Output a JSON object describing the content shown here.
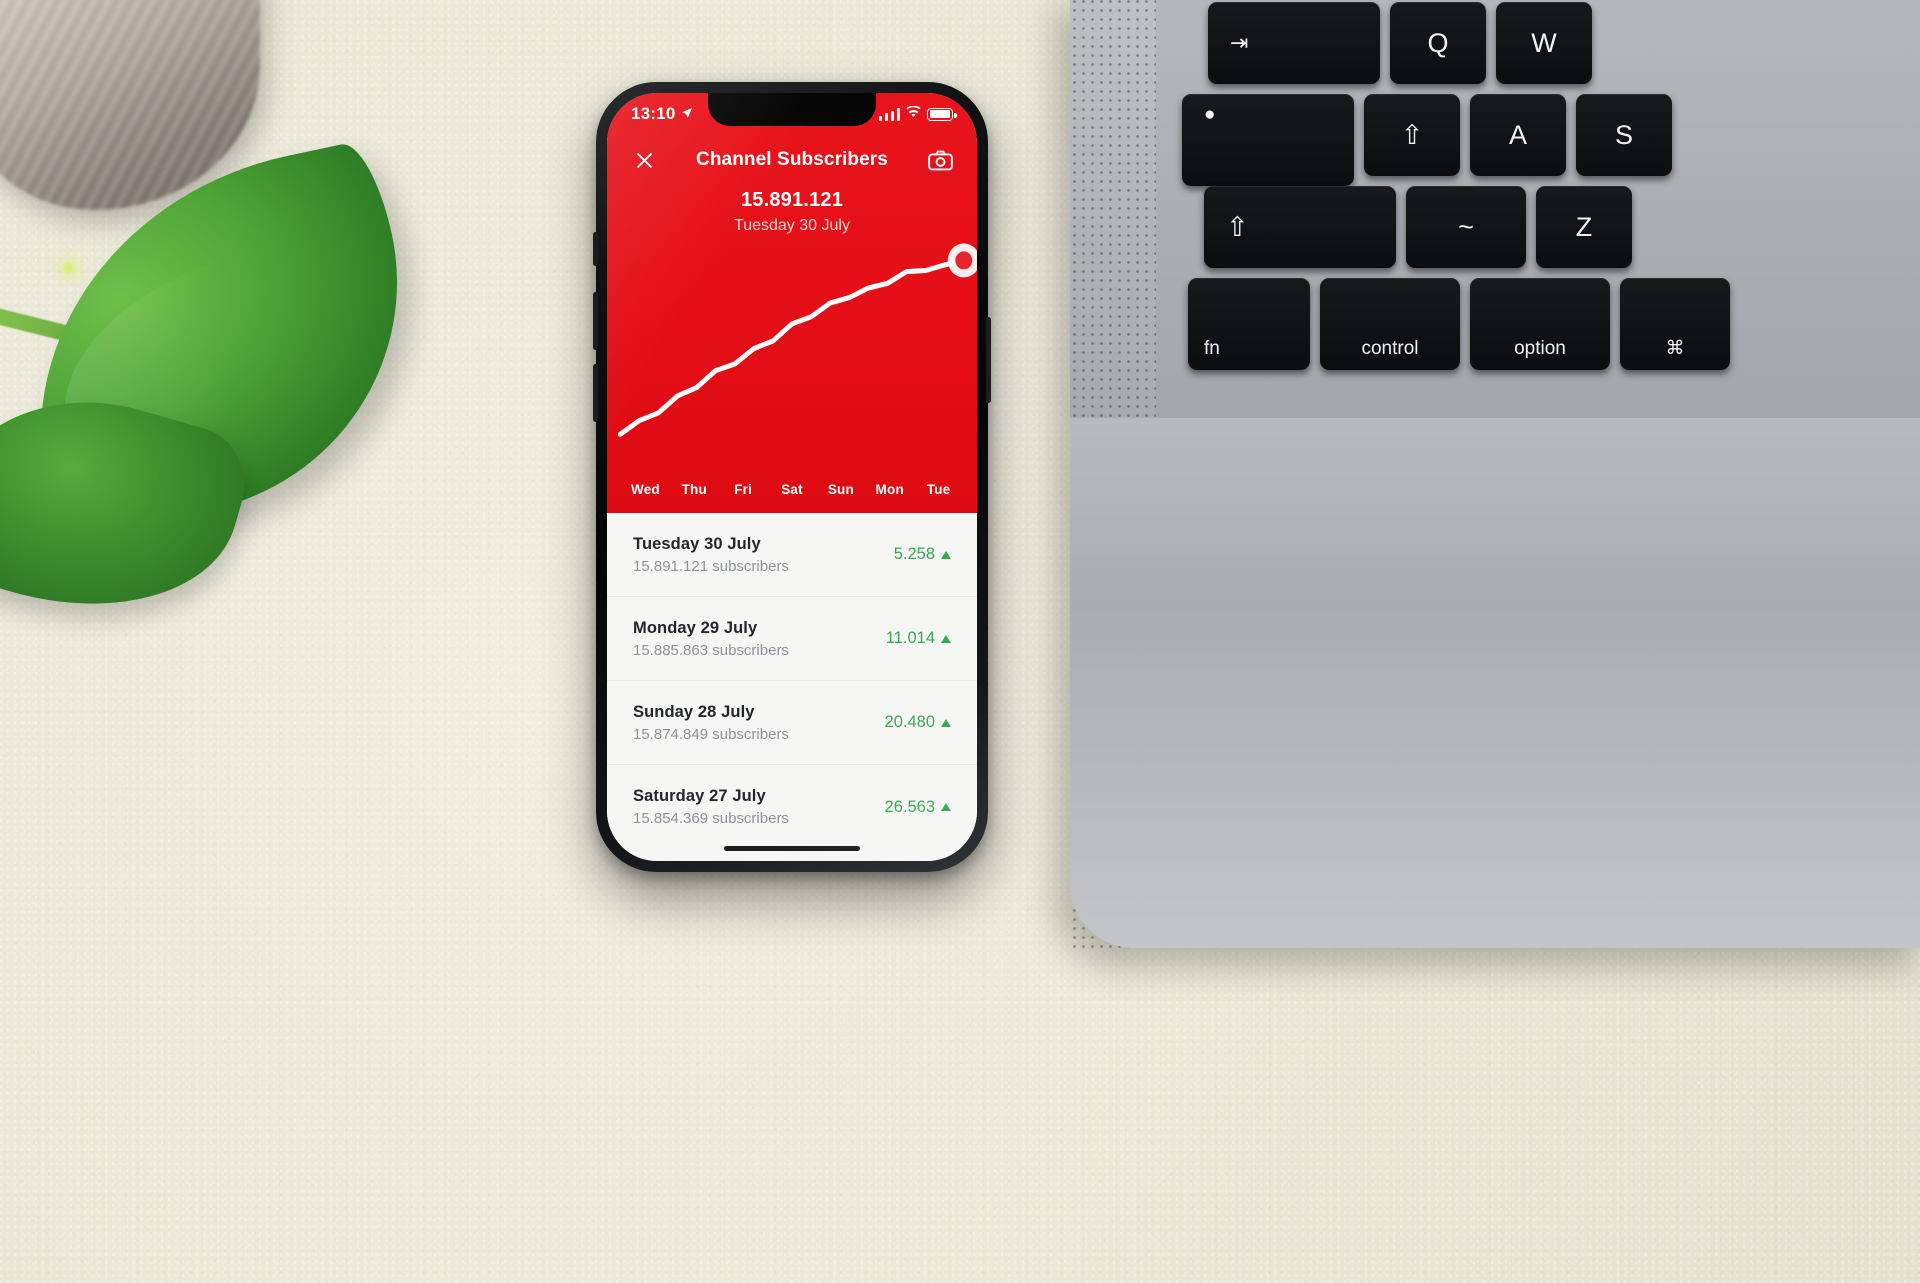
{
  "status_bar": {
    "time": "13:10",
    "location_icon": "location-arrow-icon",
    "signal_icon": "cellular-signal-icon",
    "wifi_icon": "wifi-icon",
    "battery_icon": "battery-icon"
  },
  "nav": {
    "close_icon": "close-icon",
    "title": "Channel Subscribers",
    "camera_icon": "camera-icon"
  },
  "summary": {
    "value": "15.891.121",
    "date": "Tuesday 30 July"
  },
  "chart_data": {
    "type": "line",
    "title": "Channel Subscribers",
    "xlabel": "",
    "ylabel": "",
    "grid": false,
    "legend": "none",
    "line_color": "#ffffff",
    "background_color": "#e30e16",
    "categories": [
      "Wed",
      "Thu",
      "Fri",
      "Sat",
      "Sun",
      "Mon",
      "Tue"
    ],
    "x": [
      "Wed",
      "Thu",
      "Fri",
      "Sat",
      "Sun",
      "Mon",
      "Tue"
    ],
    "series": [
      {
        "name": "Subscribers",
        "values": [
          15680000,
          15724000,
          15768000,
          15812000,
          15848000,
          15874849,
          15891121
        ]
      }
    ],
    "ylim": [
      15650000,
      15905000
    ],
    "selected_point": {
      "x": "Tue",
      "y": 15891121,
      "label": "15.891.121"
    },
    "annotations": [
      "Selected point marker on Tuesday 30 July"
    ]
  },
  "axis": {
    "days": [
      "Wed",
      "Thu",
      "Fri",
      "Sat",
      "Sun",
      "Mon",
      "Tue"
    ]
  },
  "list": {
    "rows": [
      {
        "title": "Tuesday 30 July",
        "subtitle": "15.891.121 subscribers",
        "delta": "5.258",
        "trend": "up"
      },
      {
        "title": "Monday 29 July",
        "subtitle": "15.885.863 subscribers",
        "delta": "11.014",
        "trend": "up"
      },
      {
        "title": "Sunday 28 July",
        "subtitle": "15.874.849 subscribers",
        "delta": "20.480",
        "trend": "up"
      },
      {
        "title": "Saturday 27 July",
        "subtitle": "15.854.369 subscribers",
        "delta": "26.563",
        "trend": "up"
      }
    ]
  },
  "colors": {
    "brand_red": "#e30e16",
    "positive_green": "#34a853",
    "list_bg": "#f6f6f4",
    "title_text": "#23272b",
    "sub_text": "#8d9298"
  },
  "keyboard": {
    "row1": [
      "⇥",
      "Q",
      "W"
    ],
    "row2": [
      "●",
      "⇧",
      "A",
      "S"
    ],
    "row3": [
      "⇧",
      "~",
      "Z"
    ],
    "row4": [
      "fn",
      "control",
      "option",
      "⌘"
    ]
  }
}
